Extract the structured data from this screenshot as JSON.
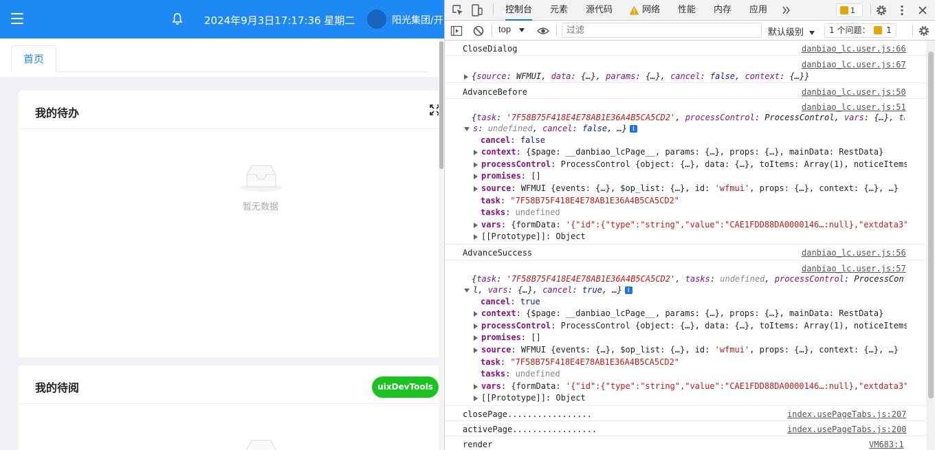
{
  "app": {
    "datetime": "2024年9月3日17:17:36 星期二",
    "company": "阳光集团/开",
    "tab_home": "首页",
    "card_todo": {
      "title": "我的待办",
      "empty_text": "暂无数据"
    },
    "card_read": {
      "title": "我的待阅"
    },
    "uix_button": "uixDevTools",
    "colors": {
      "header": "#1e88f5",
      "uix": "#1cc222"
    }
  },
  "devtools": {
    "tabs": [
      "控制台",
      "元素",
      "源代码",
      "网络",
      "性能",
      "内存",
      "应用"
    ],
    "issues_badge": "1",
    "context": "top",
    "filter_placeholder": "过滤",
    "level": "默认级别",
    "issues_label": "1 个问题：",
    "issues_num": "1",
    "messages": {
      "m1": {
        "text": "CloseDialog",
        "src": "danbiao_lc.user.js:66"
      },
      "m2": {
        "src": "danbiao_lc.user.js:67"
      },
      "m3": {
        "text": "AdvanceBefore",
        "src": "danbiao_lc.user.js:50"
      },
      "m4": {
        "src": "danbiao_lc.user.js:51"
      },
      "m5": {
        "text": "AdvanceSuccess",
        "src": "danbiao_lc.user.js:56"
      },
      "m6": {
        "src": "danbiao_lc.user.js:57"
      },
      "m7": {
        "text": "closePage.................",
        "src": "index.usePageTabs.js:207"
      },
      "m8": {
        "text": "activePage.................",
        "src": "index.usePageTabs.js:200"
      },
      "m9": {
        "text": "render",
        "src": "VM683:1"
      }
    },
    "values": {
      "task_id": "'7F58B75F418E4E78AB1E36A4B5CA5CD2'",
      "task_id_dq": "\"7F58B75F418E4E78AB1E36A4B5CA5CD2\"",
      "false": "false",
      "true": "true",
      "undefined": "undefined",
      "danbiao_page": "__danbiao_lcPage__",
      "rest_data": "RestData",
      "process_control": "ProcessControl",
      "wfmui": "WFMUI",
      "wfmui_id": "'wfmui'",
      "array1": "Array(1)",
      "empty_array": "[]",
      "object": "Object",
      "vars_value": "'{\"id\":{\"type\":\"string\",\"value\":\"CAE1FDD88DA0000146…:null},\"extdata3\":{\"",
      "ellipsis_obj": "{…}"
    }
  }
}
